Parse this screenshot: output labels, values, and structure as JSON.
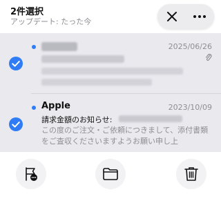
{
  "header": {
    "title": "2件選択",
    "subtitle": "アップデート: たった今",
    "close_icon": "close-icon",
    "more_icon": "ellipsis-icon"
  },
  "messages": [
    {
      "selected": true,
      "unread": true,
      "sender": "",
      "date": "2025/06/26",
      "has_attachment": true
    },
    {
      "selected": true,
      "unread": true,
      "sender": "Apple",
      "date": "2023/10/09",
      "subject": "請求金額のお知らせ:",
      "preview": "この度のご注文・ご依頼につきまして、添付書類をご査収くださいますようお願い申し上",
      "has_attachment": false
    }
  ],
  "toolbar": {
    "items": [
      "flag-more-icon",
      "folder-icon",
      "trash-icon"
    ]
  },
  "colors": {
    "accent": "#2f7cf6",
    "selected_row_bg": "#e9e9ee",
    "secondary_text": "#8e8e93"
  }
}
